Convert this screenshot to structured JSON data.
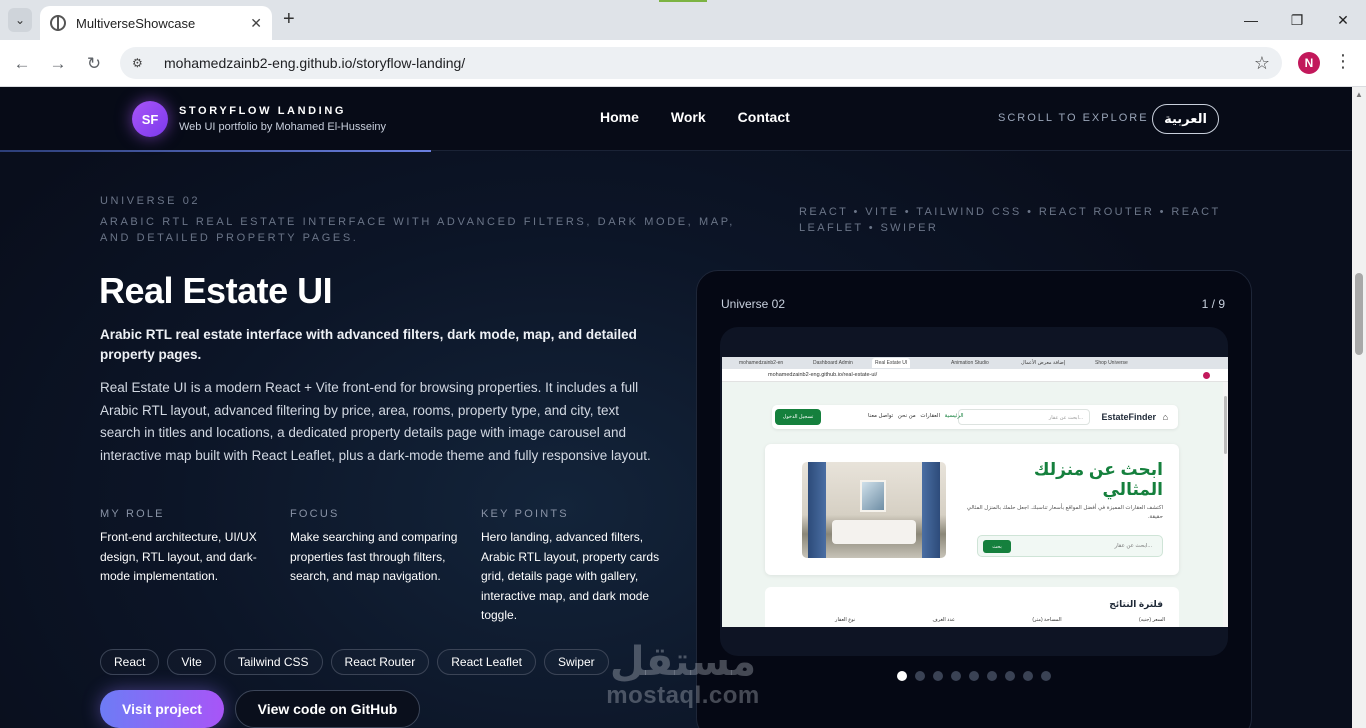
{
  "browser": {
    "tab_title": "MultiverseShowcase",
    "tab_close": "✕",
    "new_tab": "+",
    "url": "mohamedzainb2-eng.github.io/storyflow-landing/",
    "avatar_letter": "N",
    "win_minimize": "—",
    "win_restore": "❐",
    "win_close": "✕"
  },
  "header": {
    "logo": "SF",
    "title": "STORYFLOW LANDING",
    "subtitle": "Web UI portfolio by Mohamed El-Husseiny",
    "nav": [
      "Home",
      "Work",
      "Contact"
    ],
    "scroll_hint": "SCROLL TO EXPLORE",
    "lang_button": "العربية"
  },
  "project": {
    "eyebrow": "UNIVERSE 02",
    "tagline": "Arabic RTL real estate interface with advanced filters, dark mode, map, and detailed property pages.",
    "stack": "REACT • VITE • TAILWIND CSS • REACT ROUTER • REACT LEAFLET • SWIPER",
    "title": "Real Estate UI",
    "summary": "Arabic RTL real estate interface with advanced filters, dark mode, map, and detailed property pages.",
    "description": "Real Estate UI is a modern React + Vite front-end for browsing properties. It includes a full Arabic RTL layout, advanced filtering by price, area, rooms, property type, and city, text search in titles and locations, a dedicated property details page with image carousel and interactive map built with React Leaflet, plus a dark-mode theme and fully responsive layout.",
    "columns": [
      {
        "label": "MY ROLE",
        "text": "Front-end architecture, UI/UX design, RTL layout, and dark-mode implementation."
      },
      {
        "label": "FOCUS",
        "text": "Make searching and comparing properties fast through filters, search, and map navigation."
      },
      {
        "label": "KEY POINTS",
        "text": "Hero landing, advanced filters, Arabic RTL layout, property cards grid, details page with gallery, interactive map, and dark mode toggle."
      }
    ],
    "tags": [
      "React",
      "Vite",
      "Tailwind CSS",
      "React Router",
      "React Leaflet",
      "Swiper"
    ],
    "visit_button": "Visit project",
    "github_button": "View code on GitHub"
  },
  "showcase": {
    "label": "Universe 02",
    "counter": "1 / 9",
    "active_slide": 1,
    "slide_count": 9,
    "screenshot": {
      "tabs": [
        "mohamedzainb2-en",
        "Dashboard Admin",
        "Real Estate UI",
        "Animation Studio",
        "إضافة معرض الأعمال",
        "Shop Universe"
      ],
      "url": "mohamedzainb2-eng.github.io/real-estate-ui/",
      "brand": "EstateFinder",
      "search_placeholder": "ابحث عن عقار...",
      "nav_links": [
        "الرئيسية",
        "العقارات",
        "من نحن",
        "تواصل معنا"
      ],
      "login": "تسجيل الدخول",
      "hero_title": "ابحث عن منزلك المثالي",
      "hero_text": "اكتشف العقارات المميزة في أفضل المواقع بأسعار تناسبك. اجعل حلمك بالمنزل المثالي حقيقة.",
      "hero_search": "ابحث عن عقار...",
      "hero_button": "بحث",
      "filter_title": "فلترة النتائج",
      "filter_labels": [
        "السعر (جنيه)",
        "المساحة (متر)",
        "عدد الغرف",
        "نوع العقار"
      ]
    }
  },
  "watermark": {
    "ar": "مستقل",
    "en": "mostaql.com"
  }
}
